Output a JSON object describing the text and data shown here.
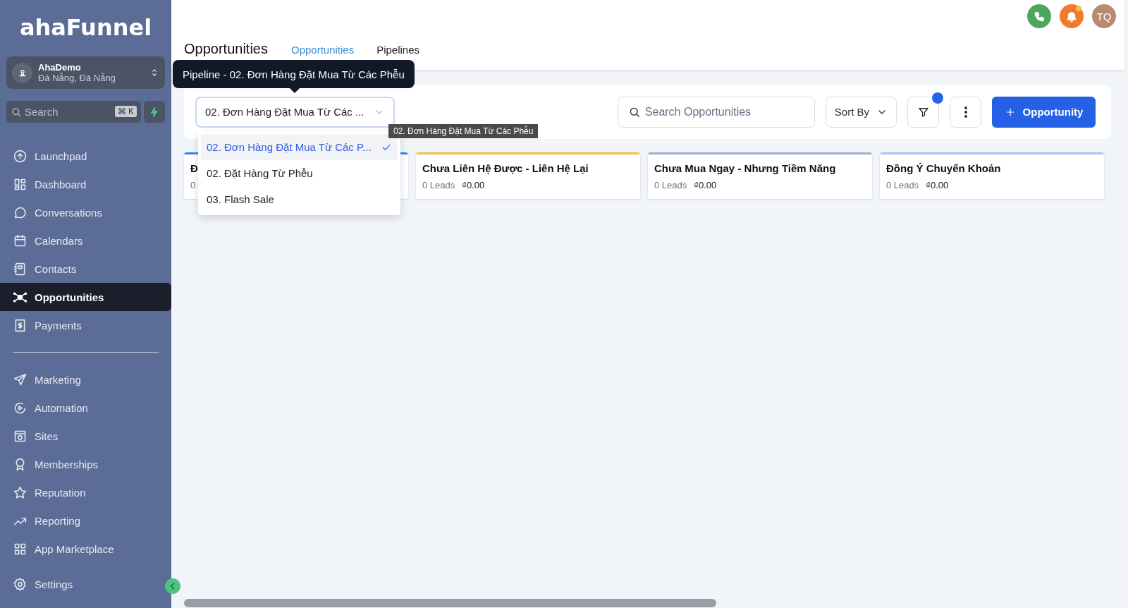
{
  "sidebar": {
    "logo": "ahaFunnel",
    "account": {
      "name": "AhaDemo",
      "location": "Đà Nẵng, Đà Nẵng"
    },
    "search": {
      "placeholder": "Search",
      "shortcut": "⌘ K"
    },
    "items": [
      {
        "label": "Launchpad",
        "selected": false
      },
      {
        "label": "Dashboard",
        "selected": false
      },
      {
        "label": "Conversations",
        "selected": false
      },
      {
        "label": "Calendars",
        "selected": false
      },
      {
        "label": "Contacts",
        "selected": false
      },
      {
        "label": "Opportunities",
        "selected": true
      },
      {
        "label": "Payments",
        "selected": false
      }
    ],
    "more_items": [
      {
        "label": "Marketing",
        "selected": false
      },
      {
        "label": "Automation",
        "selected": false
      },
      {
        "label": "Sites",
        "selected": false
      },
      {
        "label": "Memberships",
        "selected": false
      },
      {
        "label": "Reputation",
        "selected": false
      },
      {
        "label": "Reporting",
        "selected": false
      },
      {
        "label": "App Marketplace",
        "selected": false
      }
    ],
    "settings": {
      "label": "Settings",
      "selected": false
    }
  },
  "header": {
    "title": "Opportunities",
    "tabs": [
      {
        "label": "Opportunities",
        "selected": true
      },
      {
        "label": "Pipelines",
        "selected": false
      }
    ],
    "notifications_unread": true,
    "avatar": "TQ"
  },
  "toolbar": {
    "pipeline": {
      "value": "02. Đơn Hàng Đặt Mua Từ Các ...",
      "tooltip": "Pipeline - 02. Đơn Hàng Đặt Mua Từ Các Phễu",
      "expanded": true,
      "options": [
        {
          "label": "02. Đơn Hàng Đặt Mua Từ Các P...",
          "selected": true
        },
        {
          "label": "02. Đặt Hàng Từ Phễu",
          "selected": false
        },
        {
          "label": "03. Flash Sale",
          "selected": false
        }
      ],
      "hover_tooltip": "02. Đơn Hàng Đặt Mua Từ Các Phễu"
    },
    "search": {
      "placeholder": "Search Opportunities"
    },
    "sort": "Sort By",
    "filter_active": true,
    "add_button": "Opportunity"
  },
  "stages": [
    {
      "name": "Đ",
      "leads": "0",
      "color": "#3b82f6"
    },
    {
      "name": "Chưa Liên Hệ Được - Liên Hệ Lại",
      "leads": "0 Leads",
      "value": "₫0.00",
      "color": "#f5c242"
    },
    {
      "name": "Chưa Mua Ngay - Nhưng Tiềm Năng",
      "leads": "0 Leads",
      "value": "₫0.00",
      "color": "#a5a9d6"
    },
    {
      "name": "Đồng Ý Chuyển Khoản",
      "leads": "0 Leads",
      "value": "₫0.00",
      "color": "#a9c1f5"
    }
  ]
}
